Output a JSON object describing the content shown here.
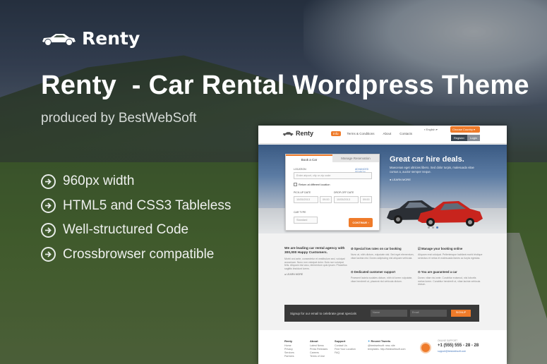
{
  "brand": {
    "logo_text": "Renty",
    "title": "Renty  - Car Rental Wordpress Theme",
    "subtitle": "produced by BestWebSoft"
  },
  "features": [
    {
      "icon": "arrow-circle-icon",
      "label": "960px width"
    },
    {
      "icon": "arrow-circle-icon",
      "label": "HTML5 and CSS3 Tableless"
    },
    {
      "icon": "arrow-circle-icon",
      "label": "Well-structured Code"
    },
    {
      "icon": "arrow-circle-icon",
      "label": "Crossbrowser compatible"
    }
  ],
  "colors": {
    "accent": "#ef7b2a",
    "dark": "#393939"
  },
  "preview": {
    "logo_text": "Renty",
    "nav": [
      "Info",
      "Terms & Conditions",
      "About",
      "Contacts"
    ],
    "language": "English",
    "currency": "Choose Country",
    "register": "Register",
    "login": "Login",
    "form": {
      "tab_book": "Book a Car",
      "tab_manage": "Manage Reservation",
      "location_label": "LOCATION",
      "advanced_link": "ADVANCED SEARCH",
      "location_placeholder": "Enter airport, city or zip code",
      "return_label": "Return at different location",
      "pickup_label": "PICK-UP DATE",
      "dropoff_label": "DROP-OFF DATE",
      "pickup_date": "10/05/2013",
      "pickup_time": "09:00",
      "dropoff_date": "10/05/2013",
      "dropoff_time": "09:00",
      "car_type_label": "CAR TYPE",
      "car_type": "Standard",
      "continue": "CONTINUE"
    },
    "hero": {
      "title": "Great car hire deals.",
      "text": "Maecenas eget ultricies libero. Sed dolor turpis, malesuada vitae cursus a, auctor semper neque.",
      "learn_more": "LEARN MORE"
    },
    "intro": {
      "heading": "We are leading car rental agency with 300,000 Happy Customers.",
      "text": "Morbi orci ante, consectetur et vestibulum sed, volutpat accumsan. Nunc non volutpat dolor. Duis non volutpat felis. Aliquam nisl arcu, elementum quis ipsum. Phasellus sagittis tincidunt lorem.",
      "link": "LEARN MORE"
    },
    "benefits": [
      {
        "heading": "Special low rates on car booking",
        "text": "Nunc at, nibh dictum, vulputate nisl. Sed eget elementum, vitae lacinia nisl. Donec adipiscing nisl aliquam vehicula."
      },
      {
        "heading": "Manage your booking online",
        "text": "Aliquam erat volutpat. Pellentesque habitant morbi tristique senectus et netus et malesuada fames ac turpis egestas."
      },
      {
        "heading": "Dedicated customer support",
        "text": "Praesent lacinia sodales dictum, nibh id lorem vulputate, vitae hendrerit ut, placerat nisl vehicula dictum."
      },
      {
        "heading": "You are guaranteed a car",
        "text": "Donec vitae nisi ante. Curabitur euismod, nisi lobortis metus lorem. Curabitur hendrerit ut, vitae lacinia vehicula dictum."
      }
    ],
    "newsletter": {
      "label": "Signup for our email to celebrate great specials",
      "name_placeholder": "Name",
      "email_placeholder": "Email",
      "button": "SIGNUP"
    },
    "footer": {
      "col1": {
        "title": "Renty",
        "links": [
          "Home",
          "Privacy",
          "Services",
          "Partners"
        ]
      },
      "col2": {
        "title": "About",
        "links": [
          "Latest News",
          "Press Releases",
          "Careers",
          "Terms of Use"
        ]
      },
      "col3": {
        "title": "Support",
        "links": [
          "Contact Us",
          "Find Your Location",
          "FAQ"
        ]
      },
      "tweets": {
        "title": "Recent Tweets",
        "text": "@bestwebsoft: new, site templates. http://bestwebsoft.com"
      },
      "support_label": "ONLINE SUPPORT",
      "phone": "+1 (555) 555 - 28 - 28",
      "email": "support@bestwebsoft.com"
    }
  }
}
